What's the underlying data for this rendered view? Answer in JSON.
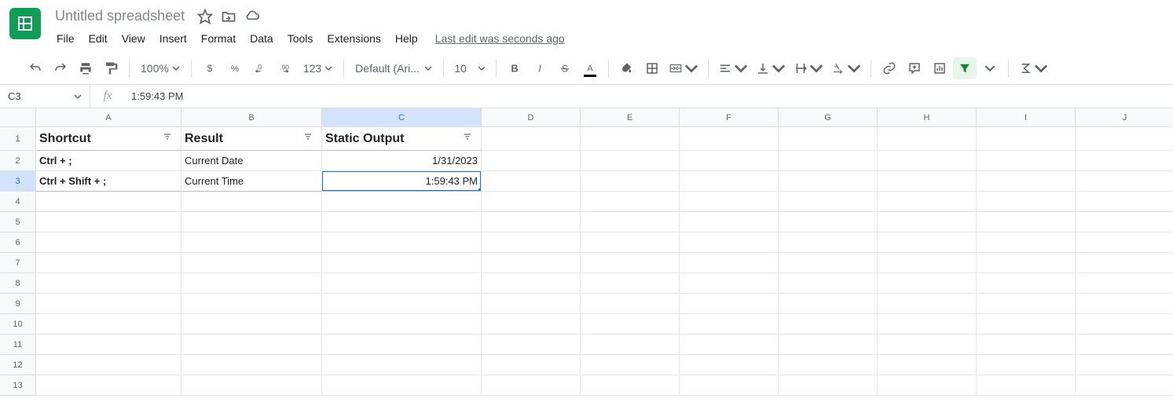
{
  "doc": {
    "title": "Untitled spreadsheet",
    "last_edit": "Last edit was seconds ago"
  },
  "menu": {
    "file": "File",
    "edit": "Edit",
    "view": "View",
    "insert": "Insert",
    "format": "Format",
    "data": "Data",
    "tools": "Tools",
    "extensions": "Extensions",
    "help": "Help"
  },
  "toolbar": {
    "zoom": "100%",
    "font": "Default (Ari...",
    "font_size": "10",
    "fmt123": "123"
  },
  "name_box": "C3",
  "formula": "1:59:43 PM",
  "columns": [
    "A",
    "B",
    "C",
    "D",
    "E",
    "F",
    "G",
    "H",
    "I",
    "J"
  ],
  "rows": [
    "1",
    "2",
    "3",
    "4",
    "5",
    "6",
    "7",
    "8",
    "9",
    "10",
    "11",
    "12",
    "13"
  ],
  "headers": {
    "a": "Shortcut",
    "b": "Result",
    "c": "Static Output"
  },
  "data": {
    "r2": {
      "a": "Ctrl + ;",
      "b": "Current Date",
      "c": "1/31/2023"
    },
    "r3": {
      "a": "Ctrl + Shift + ;",
      "b": "Current Time",
      "c": "1:59:43 PM"
    }
  },
  "active_cell": "C3"
}
